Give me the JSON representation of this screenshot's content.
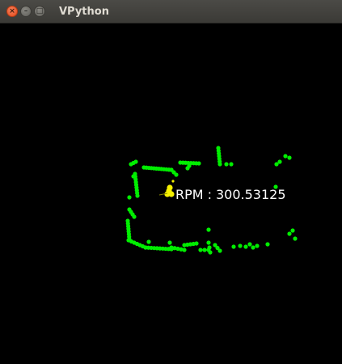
{
  "window": {
    "title": "VPython",
    "close_glyph": "×",
    "minimize_glyph": "–",
    "maximize_glyph": "□"
  },
  "scene": {
    "background_color": "#000000",
    "point_color": "#00ee00",
    "marker_color": "#f5f000"
  },
  "rpm": {
    "label": "RPM",
    "separator": ":",
    "value": "300.53125"
  }
}
